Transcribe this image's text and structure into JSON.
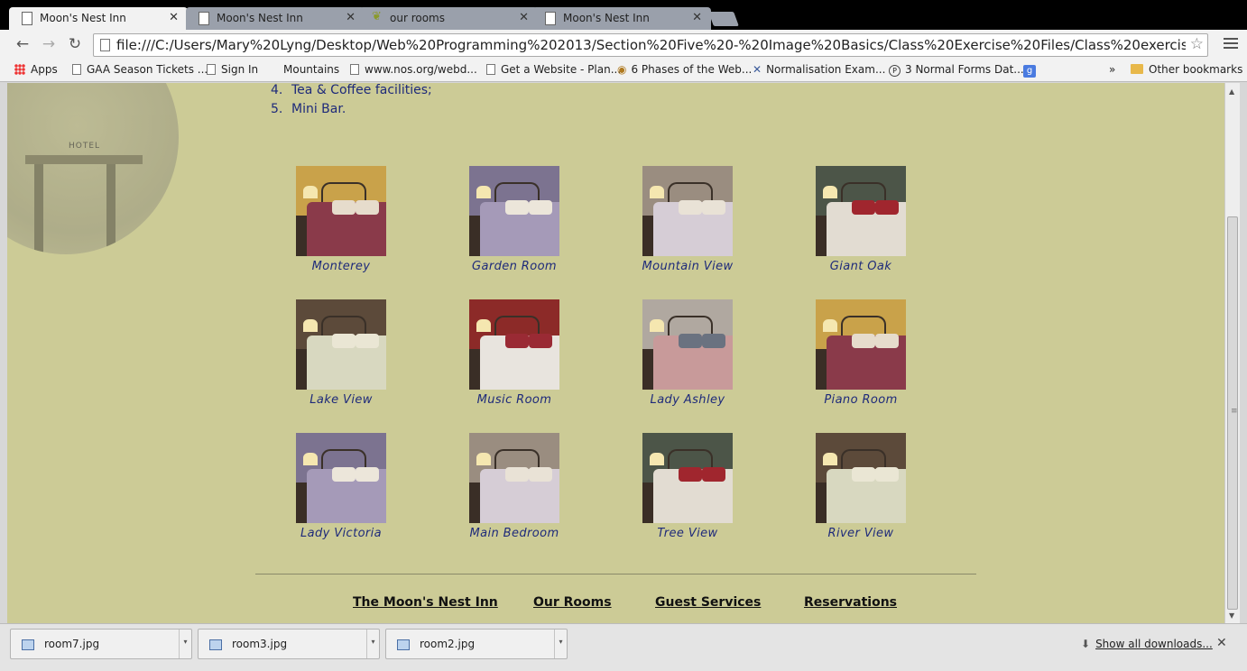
{
  "tabs": [
    {
      "title": "Moon's Nest Inn",
      "active": true,
      "icon": "page-icon"
    },
    {
      "title": "Moon's Nest Inn",
      "active": false,
      "icon": "page-icon"
    },
    {
      "title": "our rooms",
      "active": false,
      "icon": "leaf-icon"
    },
    {
      "title": "Moon's Nest Inn",
      "active": false,
      "icon": "page-icon"
    }
  ],
  "tab_close": "✕",
  "address": {
    "url": "file:///C:/Users/Mary%20Lyng/Desktop/Web%20Programming%202013/Section%20Five%20-%20Image%20Basics/Class%20Exercise%20Files/Class%20exercise%20one%"
  },
  "bookmarks": {
    "apps": "Apps",
    "items": [
      "GAA Season Tickets ...",
      "Sign In",
      "Mountains",
      "www.nos.org/webd...",
      "Get a Website - Plan...",
      "6 Phases of the Web...",
      "Normalisation Exam...",
      "3 Normal Forms Dat..."
    ],
    "google_letter": "g",
    "overflow": "»",
    "other": "Other bookmarks"
  },
  "page": {
    "logo_text": "HOTEL",
    "amenities": [
      {
        "num": "4.",
        "text": "Tea & Coffee facilities;"
      },
      {
        "num": "5.",
        "text": "Mini Bar."
      }
    ],
    "rooms": [
      "Monterey",
      "Garden Room",
      "Mountain View",
      "Giant Oak",
      "Lake View",
      "Music Room",
      "Lady Ashley",
      "Piano Room",
      "Lady Victoria",
      "Main Bedroom",
      "Tree View",
      "River View"
    ],
    "footer_links": [
      "The Moon's Nest Inn",
      "Our Rooms",
      "Guest Services",
      "Reservations"
    ]
  },
  "downloads": {
    "files": [
      "room7.jpg",
      "room3.jpg",
      "room2.jpg"
    ],
    "show_all": "Show all downloads...",
    "close": "✕"
  },
  "colors": {
    "page_bg": "#cccb96",
    "link_blue": "#1e2a7a"
  }
}
